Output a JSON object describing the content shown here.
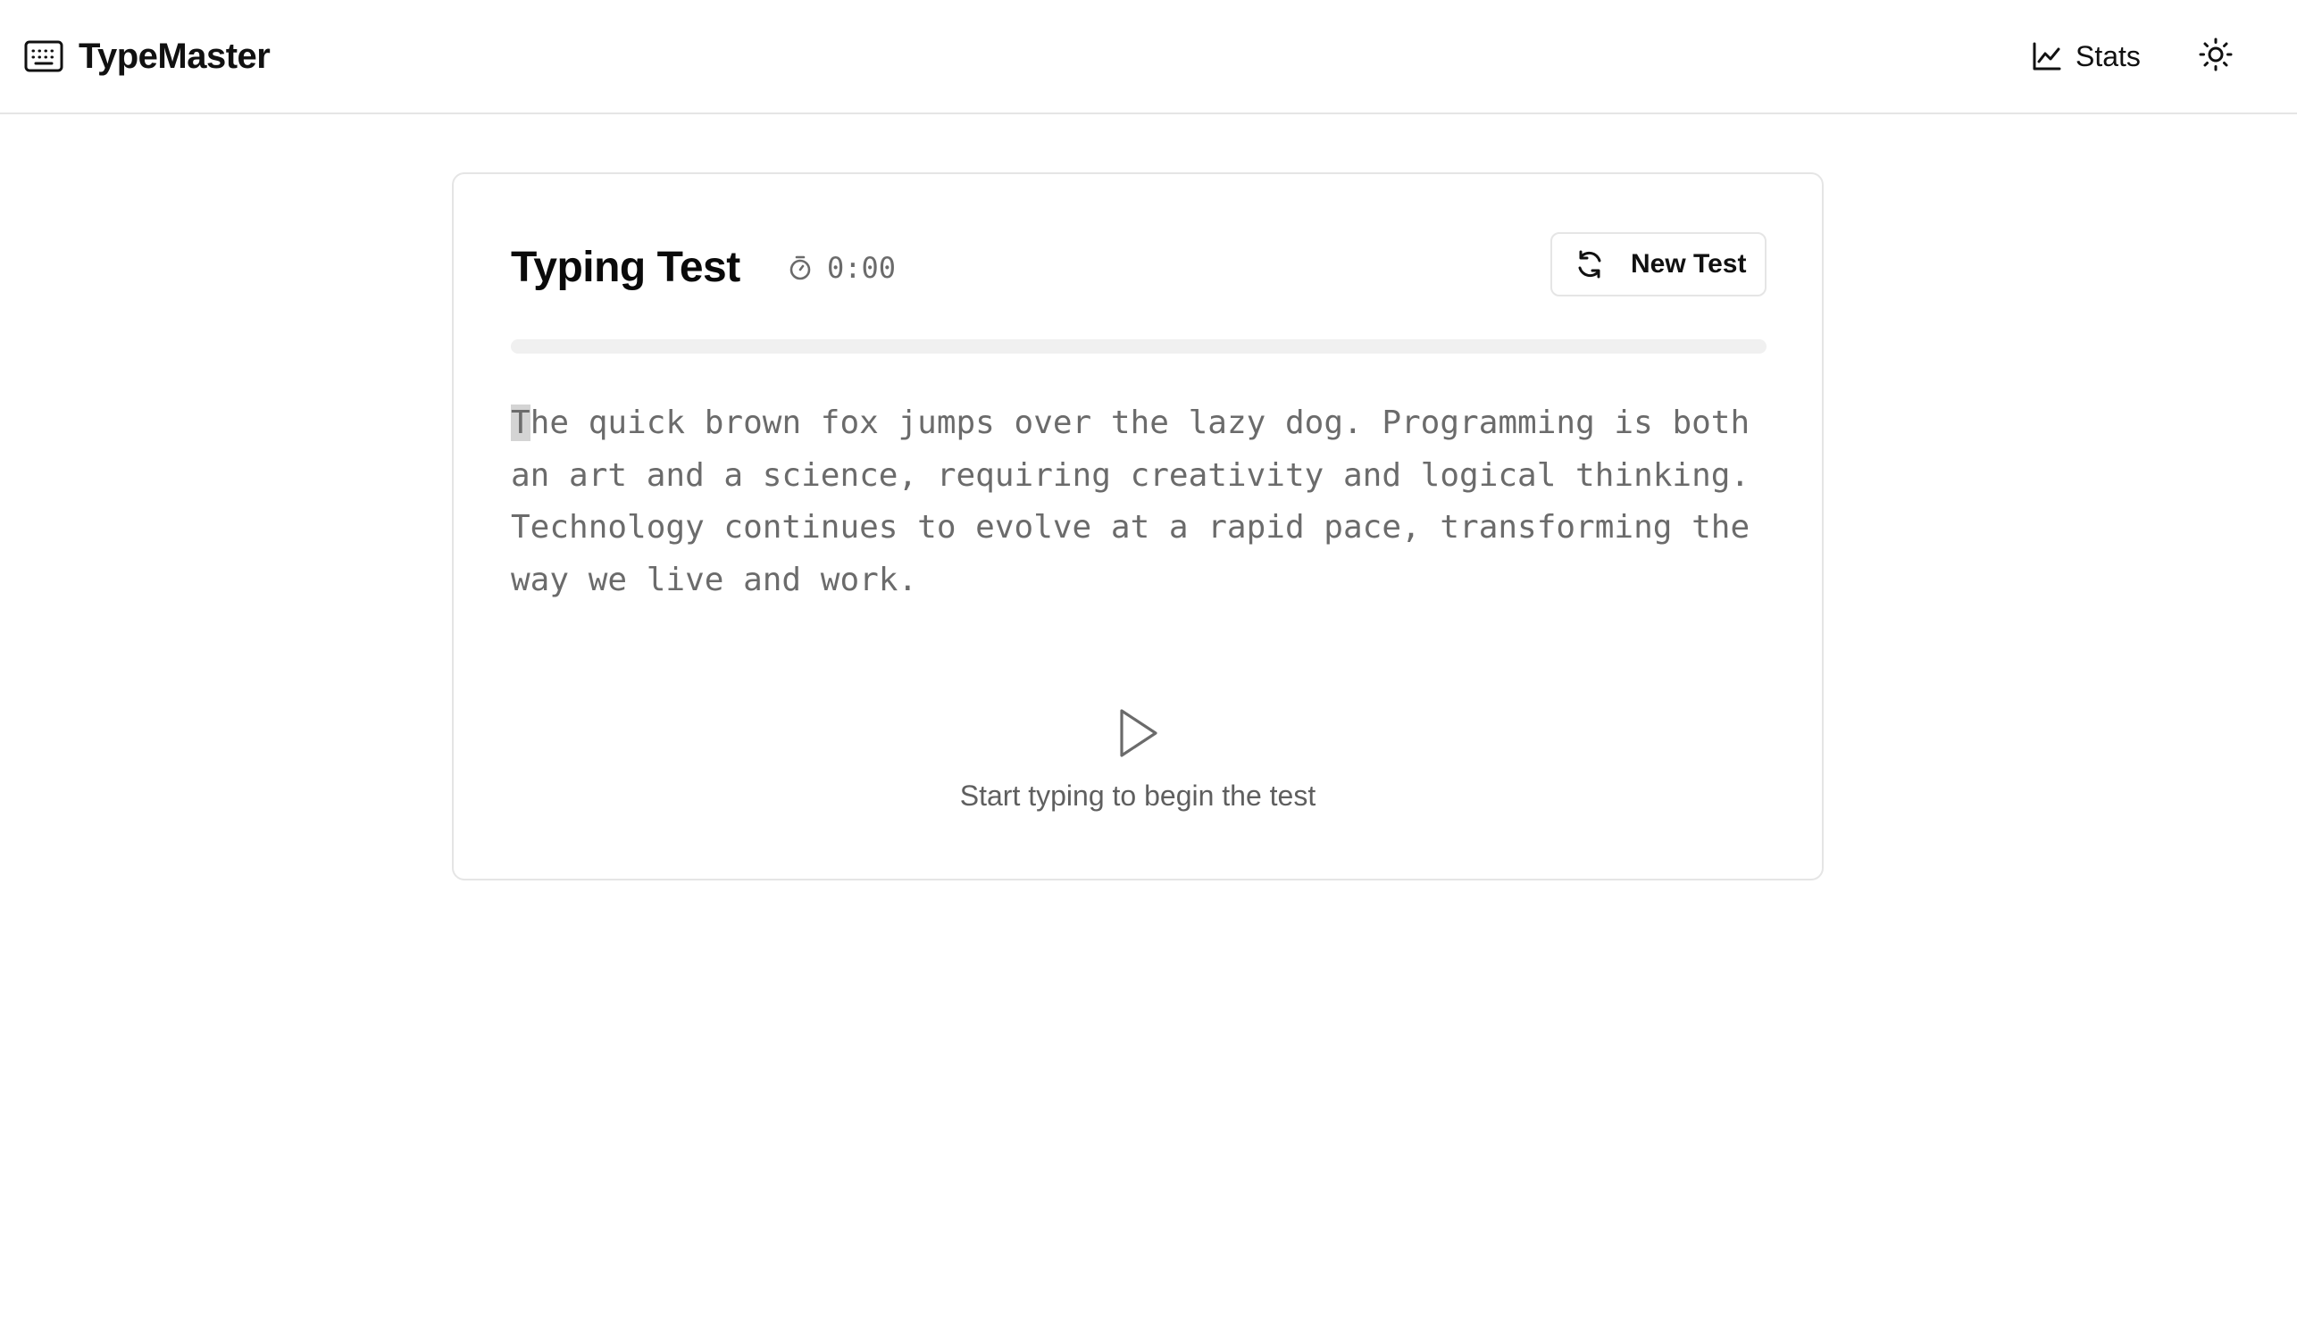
{
  "app": {
    "name": "TypeMaster",
    "logo_icon": "keyboard-icon"
  },
  "nav": {
    "stats_label": "Stats",
    "stats_icon": "line-chart-icon",
    "theme_icon": "sun-icon"
  },
  "test": {
    "title": "Typing Test",
    "timer_icon": "stopwatch-icon",
    "timer": "0:00",
    "new_test_label": "New Test",
    "new_test_icon": "refresh-icon",
    "progress_fraction": 0,
    "cursor_char": "T",
    "passage_lines": [
      "he quick brown fox jumps over the lazy dog. Programming is both",
      "an art and a science, requiring creativity and logical thinking.",
      "Technology continues to evolve at a rapid pace, transforming the",
      "way we live and work."
    ],
    "start_icon": "play-icon",
    "start_hint": "Start typing to begin the test"
  },
  "colors": {
    "text_primary": "#111111",
    "text_muted": "#6b6b6b",
    "border": "#e5e5e5",
    "cursor_highlight": "#d4d4d4"
  }
}
